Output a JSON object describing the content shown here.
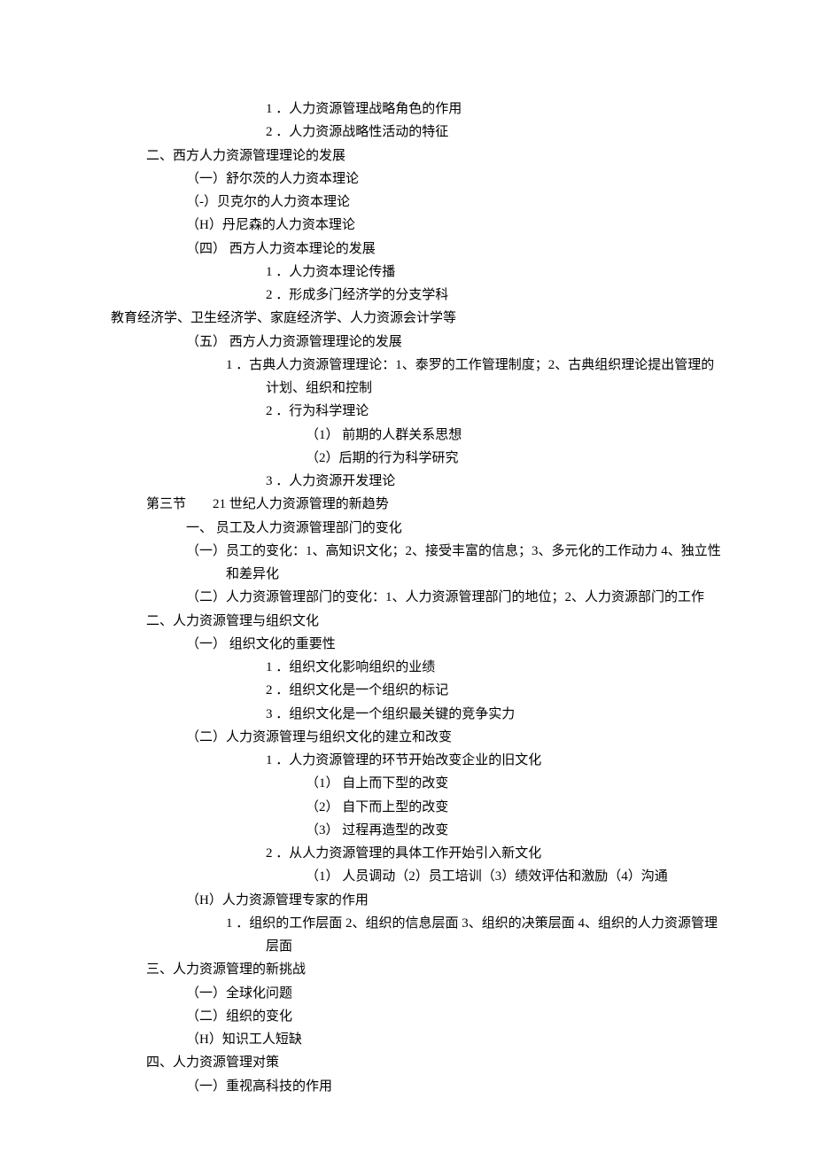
{
  "lines": {
    "a1": "1 ．人力资源管理战略角色的作用",
    "a2": "2 ．人力资源战略性活动的特征",
    "b0": "二、西方人力资源管理理论的发展",
    "b1": "（一）舒尔茨的人力资本理论",
    "b2": "（-）贝克尔的人力资本理论",
    "b3": "（H）丹尼森的人力资本理论",
    "b4": "（四） 西方人力资本理论的发展",
    "b4a": "1 ．人力资本理论传播",
    "b4b": "2 ．形成多门经济学的分支学科",
    "edu": "教育经济学、卫生经济学、家庭经济学、人力资源会计学等",
    "b5": "（五） 西方人力资源管理理论的发展",
    "b5a": "1 ．古典人力资源管理理论：1、泰罗的工作管理制度；2、古典组织理论提出管理的计划、组织和控制",
    "b5b": "2 ．行为科学理论",
    "b5b1": "（1） 前期的人群关系思想",
    "b5b2": "（2）后期的行为科学研究",
    "b5c": "3 ．人力资源开发理论",
    "sec3a": "第三节",
    "sec3b": "21 世纪人力资源管理的新趋势",
    "c0": "一、 员工及人力资源管理部门的变化",
    "c1": "（一）员工的变化：1、高知识文化；2、接受丰富的信息；3、多元化的工作动力 4、独立性和差异化",
    "c2": "（二）人力资源管理部门的变化：1、人力资源管理部门的地位；2、人力资源部门的工作",
    "d0": "二、人力资源管理与组织文化",
    "d1": "（一） 组织文化的重要性",
    "d1a": "1 ．组织文化影响组织的业绩",
    "d1b": "2 ．组织文化是一个组织的标记",
    "d1c": "3 ．组织文化是一个组织最关键的竞争实力",
    "d2": "（二）人力资源管理与组织文化的建立和改变",
    "d2a": "1 ．人力资源管理的环节开始改变企业的旧文化",
    "d2a1": "（1） 自上而下型的改变",
    "d2a2": "（2） 自下而上型的改变",
    "d2a3": "（3） 过程再造型的改变",
    "d2b": "2 ．从人力资源管理的具体工作开始引入新文化",
    "d2b1": "（1） 人员调动（2）员工培训（3）绩效评估和激励（4）沟通",
    "d3": "（H）人力资源管理专家的作用",
    "d3a": "1 ．组织的工作层面 2、组织的信息层面 3、组织的决策层面 4、组织的人力资源管理层面",
    "e0": "三、人力资源管理的新挑战",
    "e1": "（一）全球化问题",
    "e2": "（二）组织的变化",
    "e3": "（H）知识工人短缺",
    "f0": "四、人力资源管理对策",
    "f1": "（一）重视高科技的作用"
  }
}
